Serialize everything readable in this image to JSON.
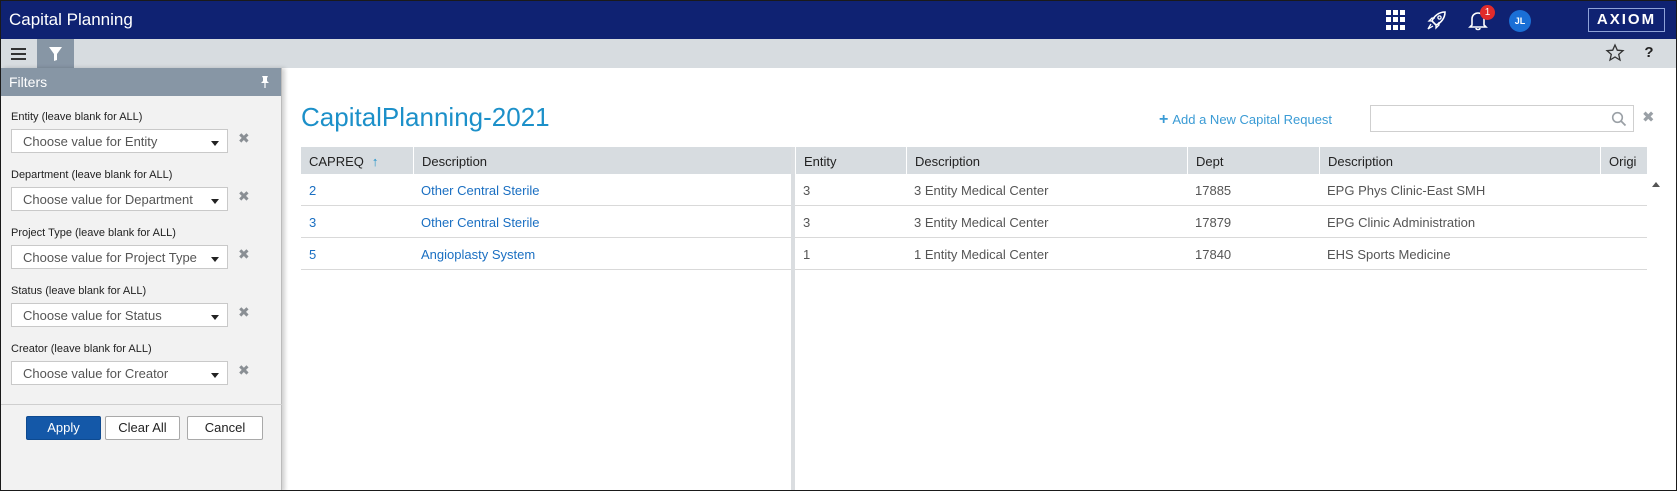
{
  "header": {
    "app_title": "Capital Planning",
    "notification_count": "1",
    "user_initials": "JL",
    "logo_text": "AXIOM",
    "brand_color": "#0f2272"
  },
  "toolbar": {
    "menu_icon": "hamburger-menu-icon",
    "filter_icon": "filter-funnel-icon",
    "favorite_icon": "star-icon",
    "help_label": "?"
  },
  "filters": {
    "title": "Filters",
    "fields": [
      {
        "label": "Entity (leave blank for ALL)",
        "placeholder": "Choose value for Entity"
      },
      {
        "label": "Department (leave blank for ALL)",
        "placeholder": "Choose value for Department"
      },
      {
        "label": "Project Type (leave blank for ALL)",
        "placeholder": "Choose value for Project Type"
      },
      {
        "label": "Status (leave blank for ALL)",
        "placeholder": "Choose value for Status"
      },
      {
        "label": "Creator (leave blank for ALL)",
        "placeholder": "Choose value for Creator"
      }
    ],
    "apply_label": "Apply",
    "clear_all_label": "Clear All",
    "cancel_label": "Cancel"
  },
  "main": {
    "page_title": "CapitalPlanning-2021",
    "add_request_label": "Add a New Capital Request",
    "search_placeholder": ""
  },
  "grid": {
    "columns": [
      "CAPREQ",
      "Description",
      "Entity",
      "Description",
      "Dept",
      "Description",
      "Origi"
    ],
    "sorted_column": "CAPREQ",
    "sort_direction": "ascending",
    "rows": [
      [
        "2",
        "Other Central Sterile",
        "3",
        "3 Entity Medical Center",
        "17885",
        "EPG Phys Clinic-East SMH"
      ],
      [
        "3",
        "Other Central Sterile",
        "3",
        "3 Entity Medical Center",
        "17879",
        "EPG Clinic Administration"
      ],
      [
        "5",
        "Angioplasty System",
        "1",
        "1 Entity Medical Center",
        "17840",
        "EHS Sports Medicine"
      ]
    ]
  }
}
